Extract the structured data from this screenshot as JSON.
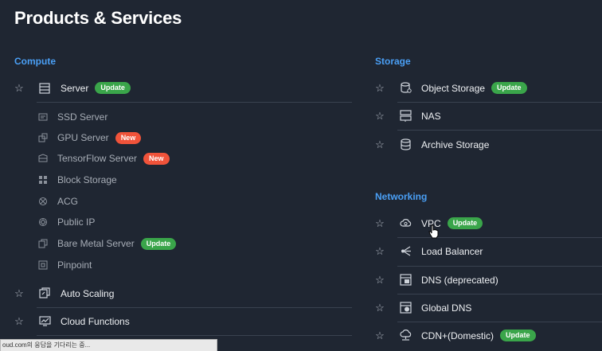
{
  "page_title": "Products & Services",
  "compute": {
    "heading": "Compute",
    "server": {
      "label": "Server",
      "badge": "Update"
    },
    "subitems": [
      {
        "label": "SSD Server"
      },
      {
        "label": "GPU Server",
        "badge": "New"
      },
      {
        "label": "TensorFlow Server",
        "badge": "New"
      },
      {
        "label": "Block Storage"
      },
      {
        "label": "ACG"
      },
      {
        "label": "Public IP"
      },
      {
        "label": "Bare Metal Server",
        "badge": "Update"
      },
      {
        "label": "Pinpoint"
      }
    ],
    "auto_scaling": {
      "label": "Auto Scaling"
    },
    "cloud_functions": {
      "label": "Cloud Functions"
    }
  },
  "storage": {
    "heading": "Storage",
    "items": [
      {
        "label": "Object Storage",
        "badge": "Update"
      },
      {
        "label": "NAS"
      },
      {
        "label": "Archive Storage"
      }
    ]
  },
  "networking": {
    "heading": "Networking",
    "items": [
      {
        "label": "VPC",
        "badge": "Update"
      },
      {
        "label": "Load Balancer"
      },
      {
        "label": "DNS (deprecated)"
      },
      {
        "label": "Global DNS"
      },
      {
        "label": "CDN+(Domestic)",
        "badge": "Update"
      }
    ]
  },
  "status_bar": {
    "text": "oud.com의 응답을 기다리는 중..."
  },
  "colors": {
    "background": "#1f2632",
    "section_heading": "#4a9ff5",
    "update_badge": "#3aa54a",
    "new_badge": "#f0533a"
  },
  "icons": {
    "star": "star-outline-icon"
  }
}
